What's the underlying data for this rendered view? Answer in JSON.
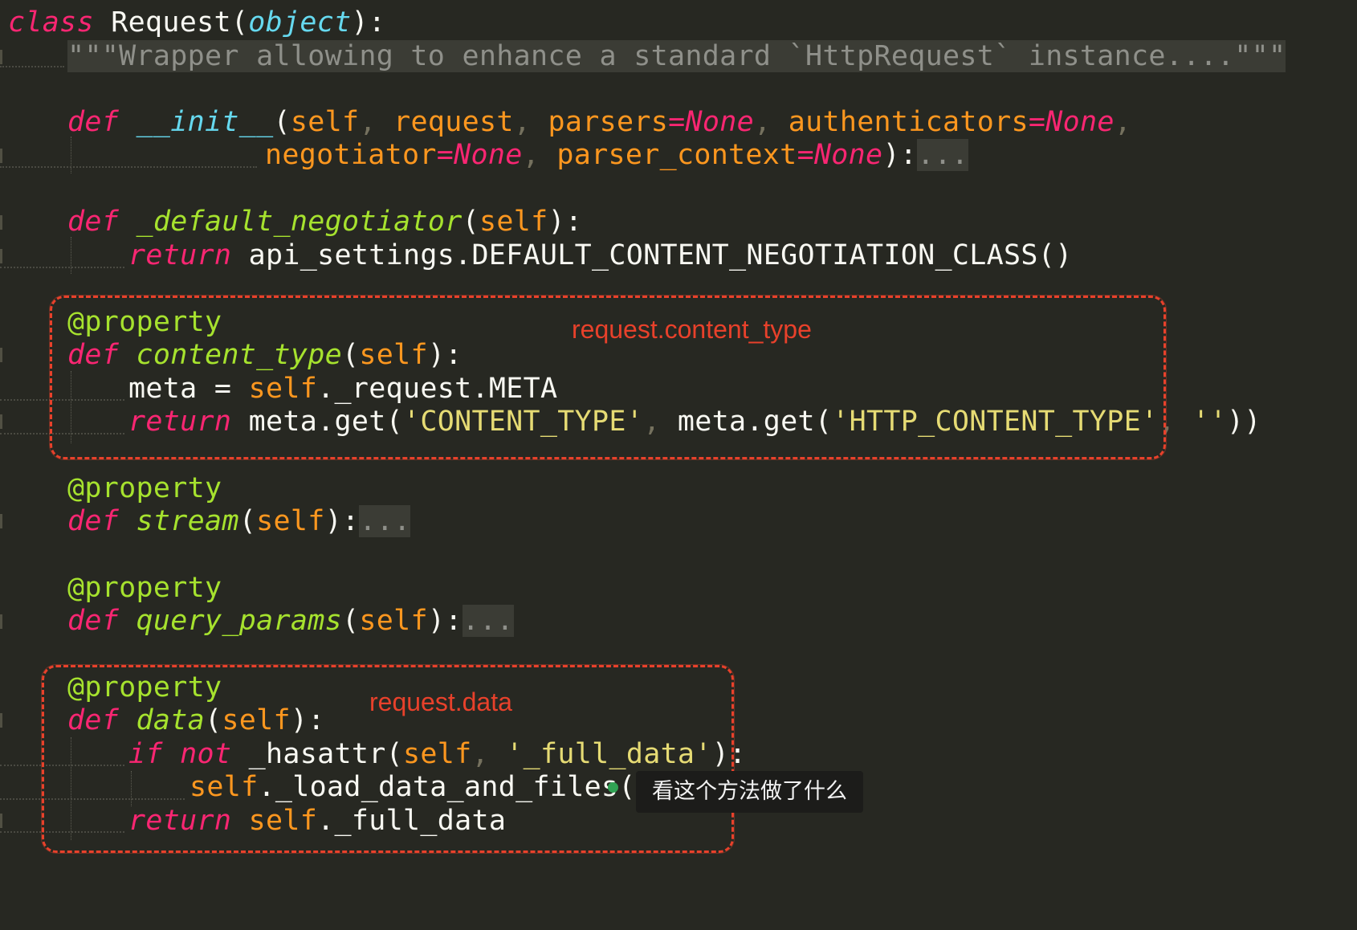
{
  "editor": {
    "theme_colors": {
      "background": "#272822",
      "keyword": "#f92672",
      "function": "#a6e22e",
      "parameter": "#fd971f",
      "string": "#e6db74",
      "builtin": "#66d9ef",
      "annotation": "#e8412b"
    },
    "code": {
      "l1_class_kw": "class",
      "l1_name": " Request(",
      "l1_base": "object",
      "l1_end": "):",
      "l2_doc": "\"\"\"Wrapper allowing to enhance a standard `HttpRequest` instance....\"\"\"",
      "l4_def": "def",
      "l4_name": "__init__",
      "l4_open": "(",
      "l4_self": "self",
      "l4_c1": ", ",
      "l4_p1": "request",
      "l4_c2": ", ",
      "l4_p2": "parsers",
      "l4_eq1": "=",
      "l4_n1": "None",
      "l4_c3": ", ",
      "l4_p3": "authenticators",
      "l4_eq2": "=",
      "l4_n2": "None",
      "l4_c4": ",",
      "l5_p4": "negotiator",
      "l5_eq3": "=",
      "l5_n3": "None",
      "l5_c5": ", ",
      "l5_p5": "parser_context",
      "l5_eq4": "=",
      "l5_n4": "None",
      "l5_close": "):",
      "l5_fold": "...",
      "l7_def": "def",
      "l7_name": "_default_negotiator",
      "l7_open": "(",
      "l7_self": "self",
      "l7_close": "):",
      "l8_ret": "return",
      "l8_expr": " api_settings.DEFAULT_CONTENT_NEGOTIATION_CLASS()",
      "l10_dec": "@property",
      "l11_def": "def",
      "l11_name": "content_type",
      "l11_open": "(",
      "l11_self": "self",
      "l11_close": "):",
      "l12_a": "meta = ",
      "l12_self": "self",
      "l12_b": "._request.META",
      "l13_ret": "return",
      "l13_a": " meta.get(",
      "l13_s1": "'CONTENT_TYPE'",
      "l13_c1": ", ",
      "l13_b": "meta.get(",
      "l13_s2": "'HTTP_CONTENT_TYPE'",
      "l13_c2": ", ",
      "l13_s3": "''",
      "l13_end": "))",
      "l15_dec": "@property",
      "l16_def": "def",
      "l16_name": "stream",
      "l16_open": "(",
      "l16_self": "self",
      "l16_close": "):",
      "l16_fold": "...",
      "l18_dec": "@property",
      "l19_def": "def",
      "l19_name": "query_params",
      "l19_open": "(",
      "l19_self": "self",
      "l19_close": "):",
      "l19_fold": "...",
      "l21_dec": "@property",
      "l22_def": "def",
      "l22_name": "data",
      "l22_open": "(",
      "l22_self": "self",
      "l22_close": "):",
      "l23_if": "if",
      "l23_not": "not",
      "l23_a": " _hasattr(",
      "l23_self": "self",
      "l23_c": ", ",
      "l23_s": "'_full_data'",
      "l23_end": "):",
      "l24_self": "self",
      "l24_a": "._load_data_and_files()",
      "l25_ret": "return",
      "l25_self": "self",
      "l25_a": "._full_data"
    }
  },
  "annotations": {
    "box1_label": "request.content_type",
    "box2_label": "request.data",
    "tooltip": "看这个方法做了什么"
  }
}
